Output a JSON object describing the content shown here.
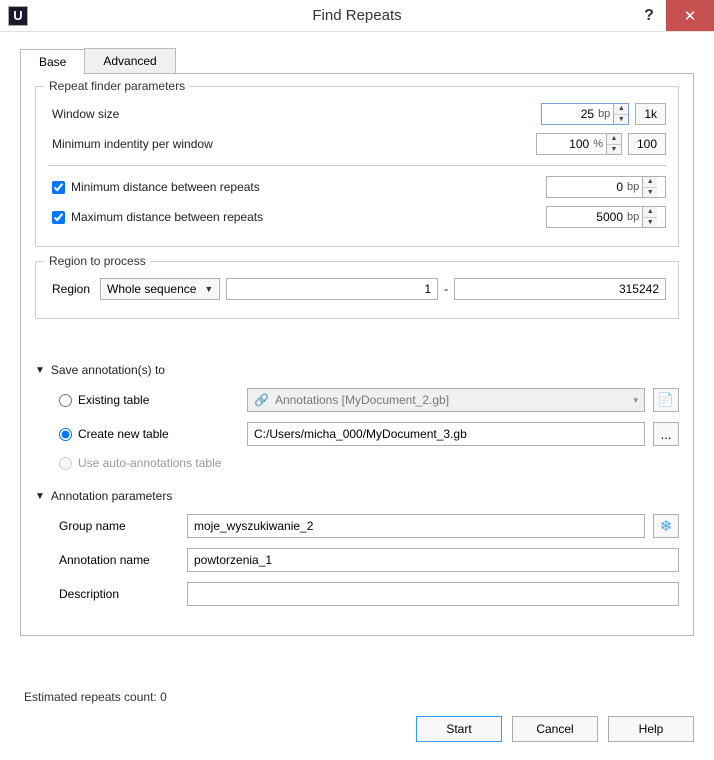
{
  "window": {
    "title": "Find Repeats",
    "app_icon_letter": "U",
    "help_glyph": "?",
    "close_glyph": "✕"
  },
  "tabs": {
    "base": "Base",
    "advanced": "Advanced"
  },
  "repeat_finder": {
    "legend": "Repeat finder parameters",
    "window_size_label": "Window size",
    "window_size_value": "25",
    "window_size_unit": "bp",
    "btn_1k": "1k",
    "min_identity_label": "Minimum indentity per window",
    "min_identity_value": "100",
    "min_identity_unit": "%",
    "btn_100": "100",
    "min_dist_label": "Minimum distance between repeats",
    "min_dist_checked": true,
    "min_dist_value": "0",
    "min_dist_unit": "bp",
    "max_dist_label": "Maximum distance between repeats",
    "max_dist_checked": true,
    "max_dist_value": "5000",
    "max_dist_unit": "bp"
  },
  "region": {
    "legend": "Region to process",
    "label": "Region",
    "combo": "Whole sequence",
    "from": "1",
    "dash": "-",
    "to": "315242"
  },
  "save": {
    "header": "Save annotation(s) to",
    "existing_label": "Existing table",
    "existing_value": "Annotations [MyDocument_2.gb]",
    "create_label": "Create new table",
    "create_value": "C:/Users/micha_000/MyDocument_3.gb",
    "browse": "...",
    "auto_label": "Use auto-annotations table"
  },
  "anno": {
    "header": "Annotation parameters",
    "group_label": "Group name",
    "group_value": "moje_wyszukiwanie_2",
    "name_label": "Annotation name",
    "name_value": "powtorzenia_1",
    "desc_label": "Description",
    "desc_value": ""
  },
  "footer": {
    "estimate": "Estimated repeats count: 0",
    "start": "Start",
    "cancel": "Cancel",
    "help": "Help"
  }
}
